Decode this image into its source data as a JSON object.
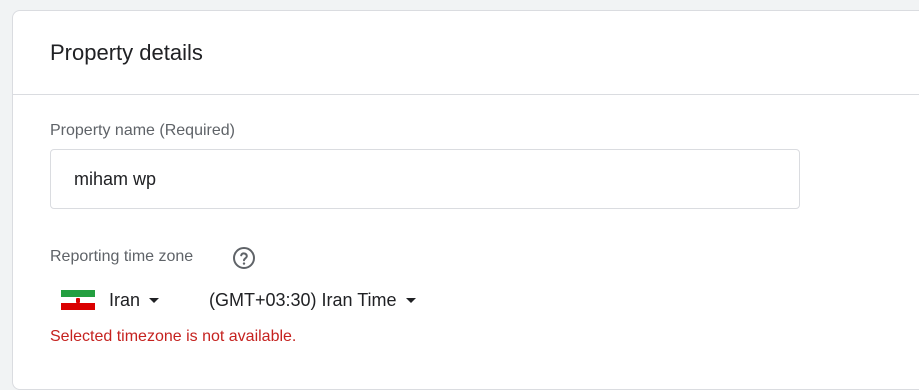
{
  "card": {
    "title": "Property details"
  },
  "property_name": {
    "label": "Property name (Required)",
    "value": "miham wp"
  },
  "reporting_time_zone": {
    "label": "Reporting time zone",
    "help_icon": "help-circle-icon",
    "country": {
      "value": "Iran",
      "flag_icon": "iran-flag-icon",
      "flag_colors": [
        "#239f40",
        "#ffffff",
        "#da0000"
      ]
    },
    "timezone": {
      "value": "(GMT+03:30) Iran Time"
    },
    "error": "Selected timezone is not available.",
    "error_color": "#c5221f"
  }
}
